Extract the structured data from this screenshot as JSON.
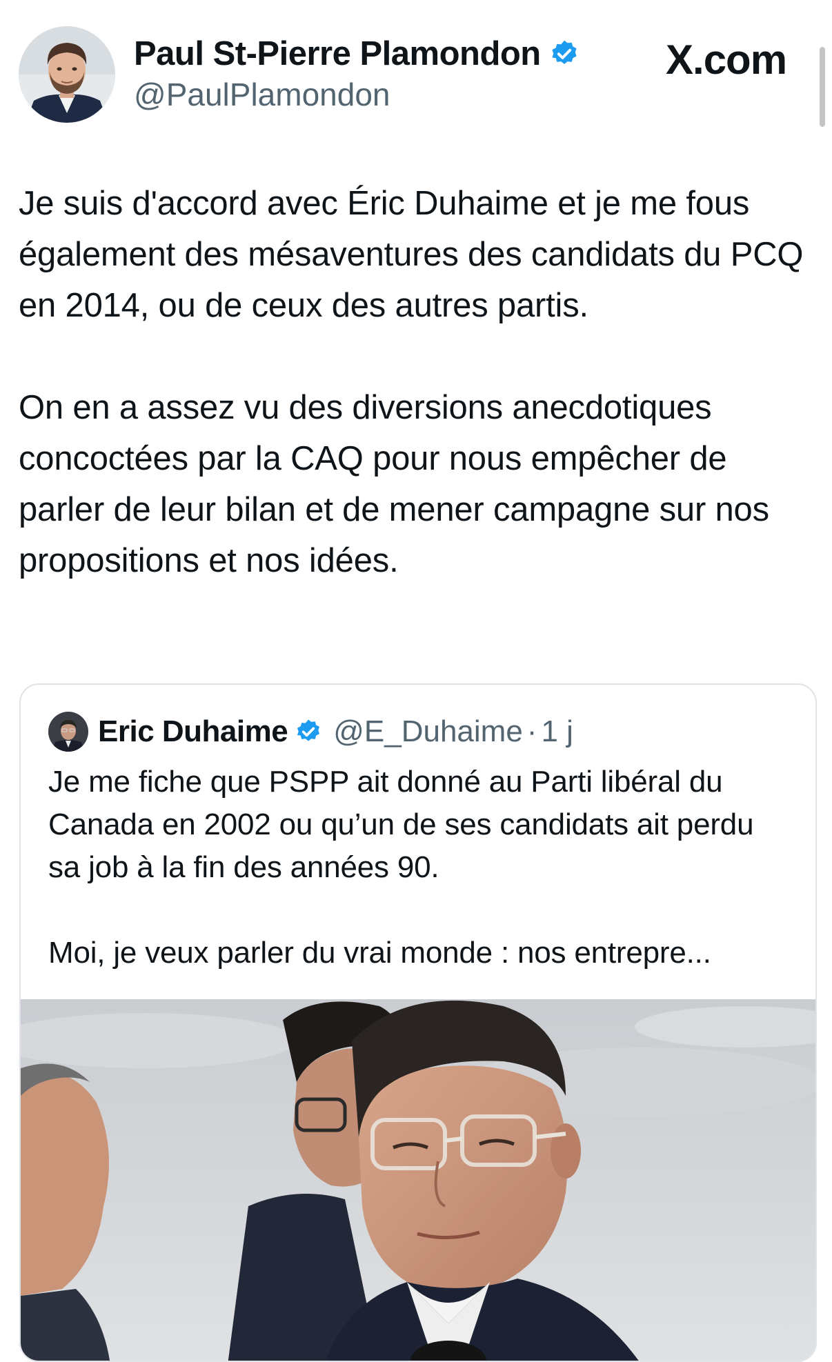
{
  "author": {
    "name": "Paul St-Pierre Plamondon",
    "handle": "@PaulPlamondon",
    "verified_color": "#1d9bf0"
  },
  "source_logo": "X.com",
  "tweet": {
    "paragraphs": [
      "Je suis d'accord avec Éric Duhaime et je me fous également des mésaventures des candidats du PCQ en 2014, ou de ceux des autres partis.",
      "On en a assez vu des diversions anecdotiques concoctées par la CAQ pour nous empêcher de parler de leur bilan et de mener campagne sur nos propositions et nos idées."
    ]
  },
  "quoted_tweet": {
    "name": "Eric Duhaime",
    "handle": "@E_Duhaime",
    "separator": "·",
    "time": "1 j",
    "paragraphs": [
      "Je me fiche que PSPP ait donné au Parti libéral du Canada en 2002 ou qu’un de ses candidats ait perdu sa job à la fin des années 90.",
      "Moi, je veux parler du vrai monde : nos entrepre..."
    ],
    "media": "photo-men-outdoors"
  },
  "colors": {
    "text": "#0f1419",
    "secondary": "#536471",
    "border": "#dfe3e8",
    "verified": "#1d9bf0"
  }
}
